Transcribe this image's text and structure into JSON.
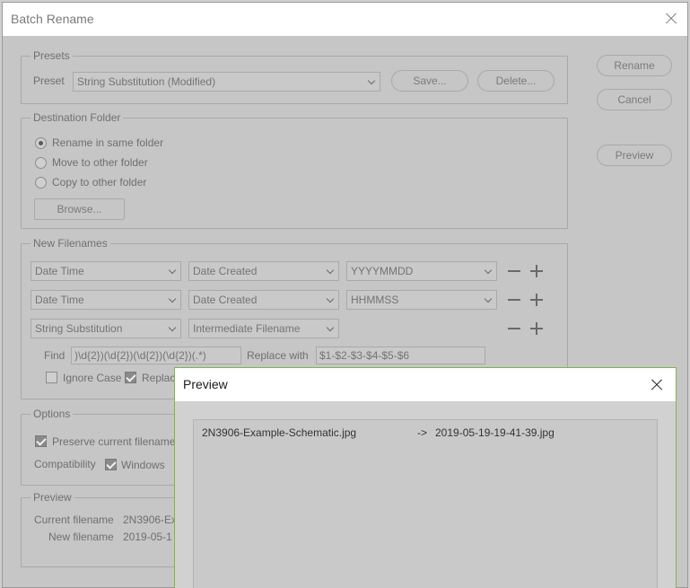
{
  "window": {
    "title": "Batch Rename"
  },
  "side_buttons": {
    "rename": "Rename",
    "cancel": "Cancel",
    "preview": "Preview"
  },
  "presets": {
    "legend": "Presets",
    "label": "Preset",
    "selected": "String Substitution (Modified)",
    "save": "Save...",
    "delete": "Delete..."
  },
  "destination": {
    "legend": "Destination Folder",
    "options": [
      "Rename in same folder",
      "Move to other folder",
      "Copy to other folder"
    ],
    "selected_index": 0,
    "browse": "Browse..."
  },
  "new_filenames": {
    "legend": "New Filenames",
    "rows": [
      {
        "type": "Date Time",
        "source": "Date Created",
        "format": "YYYYMMDD"
      },
      {
        "type": "Date Time",
        "source": "Date Created",
        "format": "HHMMSS"
      },
      {
        "type": "String Substitution",
        "source": "Intermediate Filename"
      }
    ],
    "find_label": "Find",
    "find_value": ")\\d{2})(\\d{2})(\\d{2})(\\d{2})(.*)",
    "replace_label": "Replace with",
    "replace_value": "$1-$2-$3-$4-$5-$6",
    "ignore_case_label": "Ignore Case",
    "ignore_case_checked": false,
    "replace_all_label": "Replac",
    "replace_all_checked": true
  },
  "options": {
    "legend": "Options",
    "preserve_label": "Preserve current filename",
    "preserve_checked": true,
    "compat_label": "Compatibility",
    "windows_label": "Windows",
    "windows_checked": true
  },
  "preview_section": {
    "legend": "Preview",
    "current_label": "Current filename",
    "current_value": "2N3906-Ex",
    "new_label": "New filename",
    "new_value": "2019-05-1"
  },
  "preview_popup": {
    "title": "Preview",
    "rows": [
      {
        "from": "2N3906-Example-Schematic.jpg",
        "arrow": "->",
        "to": "2019-05-19-19-41-39.jpg"
      }
    ]
  },
  "colors": {
    "popup_border": "#7ab847",
    "dialog_bg": "#c6c6c6"
  }
}
